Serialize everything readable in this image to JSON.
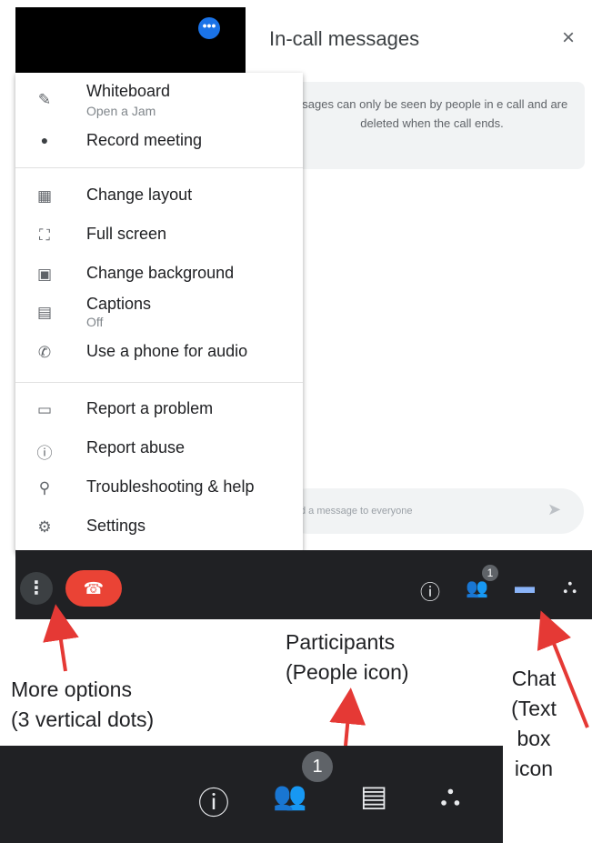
{
  "chat": {
    "title": "In-call messages",
    "close_glyph": "×",
    "note": "ssages can only be seen by people in e call and are deleted when the call ends.",
    "input_placeholder": "d a message to everyone",
    "send_glyph": "➤"
  },
  "video": {
    "more_badge": "•••"
  },
  "menu": {
    "items": [
      {
        "icon": "pencil-icon",
        "glyph": "✎",
        "label": "Whiteboard",
        "sublabel": "Open a Jam"
      },
      {
        "icon": "record-dot-icon",
        "glyph": "●",
        "label": "Record meeting",
        "sublabel": ""
      },
      {
        "icon": "layout-icon",
        "glyph": "▦",
        "label": "Change layout",
        "sublabel": ""
      },
      {
        "icon": "fullscreen-icon",
        "glyph": "⛶",
        "label": "Full screen",
        "sublabel": ""
      },
      {
        "icon": "background-icon",
        "glyph": "▣",
        "label": "Change background",
        "sublabel": ""
      },
      {
        "icon": "captions-icon",
        "glyph": "▤",
        "label": "Captions",
        "sublabel": "Off"
      },
      {
        "icon": "phone-icon",
        "glyph": "✆",
        "label": "Use a phone for audio",
        "sublabel": ""
      },
      {
        "icon": "report-problem-icon",
        "glyph": "▭",
        "label": "Report a problem",
        "sublabel": ""
      },
      {
        "icon": "report-abuse-icon",
        "glyph": "ⓘ",
        "label": "Report abuse",
        "sublabel": ""
      },
      {
        "icon": "troubleshoot-icon",
        "glyph": "⚲",
        "label": "Troubleshooting & help",
        "sublabel": ""
      },
      {
        "icon": "settings-icon",
        "glyph": "⚙",
        "label": "Settings",
        "sublabel": ""
      }
    ]
  },
  "bar": {
    "more_glyph": "⋮",
    "hangup_glyph": "☎",
    "info_glyph": "ⓘ",
    "people_glyph": "👥",
    "participants_count": "1",
    "chat_glyph": "▬",
    "activities_glyph": "⛬"
  },
  "annotations": {
    "more_options": "More options\n(3 vertical dots)",
    "participants": "Participants\n(People icon)",
    "chat": "Chat\n(Text\nbox\nicon"
  },
  "zoom_bar": {
    "info_glyph": "ⓘ",
    "people_glyph": "👥",
    "participants_count": "1",
    "chat_glyph": "▤",
    "activities_glyph": "⛬"
  },
  "colors": {
    "bar_bg": "#202124",
    "hangup_red": "#ea4335",
    "chat_active_blue": "#8ab4f8",
    "arrow_red": "#e53935"
  }
}
